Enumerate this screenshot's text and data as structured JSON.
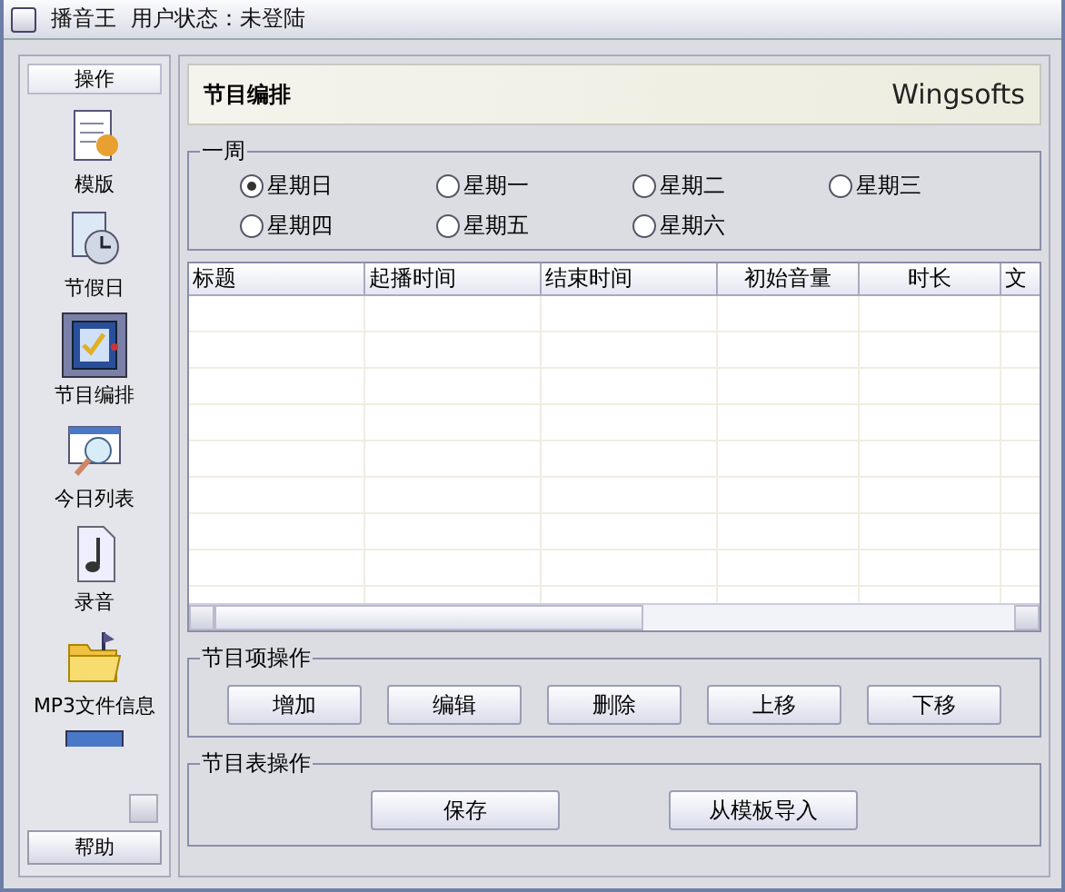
{
  "window": {
    "title": "播音王",
    "status": "用户状态：未登陆"
  },
  "sidebar": {
    "header": "操作",
    "items": [
      {
        "label": "模版",
        "kind": "template",
        "selected": false
      },
      {
        "label": "节假日",
        "kind": "holiday",
        "selected": false
      },
      {
        "label": "节目编排",
        "kind": "schedule",
        "selected": true
      },
      {
        "label": "今日列表",
        "kind": "today",
        "selected": false
      },
      {
        "label": "录音",
        "kind": "record",
        "selected": false
      },
      {
        "label": "MP3文件信息",
        "kind": "mp3",
        "selected": false
      }
    ],
    "help": "帮助"
  },
  "header": {
    "title": "节目编排",
    "brand": "Wingsofts"
  },
  "week": {
    "title": "一周",
    "days": [
      {
        "label": "星期日",
        "selected": true
      },
      {
        "label": "星期一",
        "selected": false
      },
      {
        "label": "星期二",
        "selected": false
      },
      {
        "label": "星期三",
        "selected": false
      },
      {
        "label": "星期四",
        "selected": false
      },
      {
        "label": "星期五",
        "selected": false
      },
      {
        "label": "星期六",
        "selected": false
      }
    ]
  },
  "table": {
    "columns": [
      "标题",
      "起播时间",
      "结束时间",
      "初始音量",
      "时长",
      "文"
    ]
  },
  "item_ops": {
    "title": "节目项操作",
    "buttons": [
      "增加",
      "编辑",
      "删除",
      "上移",
      "下移"
    ]
  },
  "list_ops": {
    "title": "节目表操作",
    "buttons": [
      "保存",
      "从模板导入"
    ]
  }
}
